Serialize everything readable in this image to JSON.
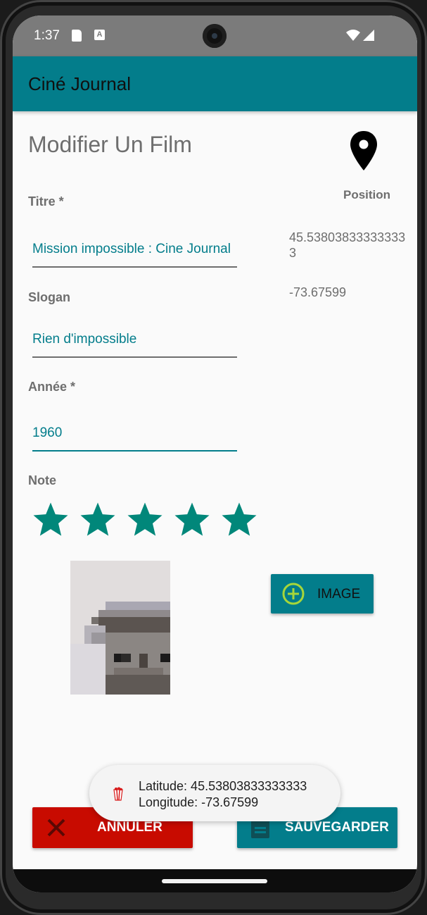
{
  "status_bar": {
    "time": "1:37",
    "a_badge": "A"
  },
  "app_bar": {
    "title": "Ciné Journal"
  },
  "page": {
    "title": "Modifier Un Film"
  },
  "form": {
    "title_label": "Titre *",
    "title_value": "Mission impossible : Cine Journal",
    "slogan_label": "Slogan",
    "slogan_value": "Rien d'impossible",
    "year_label": "Année *",
    "year_value": "1960",
    "rating_label": "Note",
    "rating_value": 5,
    "rating_max": 5
  },
  "location": {
    "icon": "location-pin-icon",
    "label": "Position",
    "latitude": "45.538038333333333",
    "longitude": "-73.67599"
  },
  "buttons": {
    "image_label": "IMAGE",
    "cancel_label": "ANNULER",
    "save_label": "SAUVEGARDER"
  },
  "toast": {
    "line1": "Latitude: 45.53803833333333",
    "line2": "Longitude: -73.67599"
  },
  "colors": {
    "accent": "#037d8b",
    "cancel": "#c80b00",
    "star": "#01877a"
  }
}
